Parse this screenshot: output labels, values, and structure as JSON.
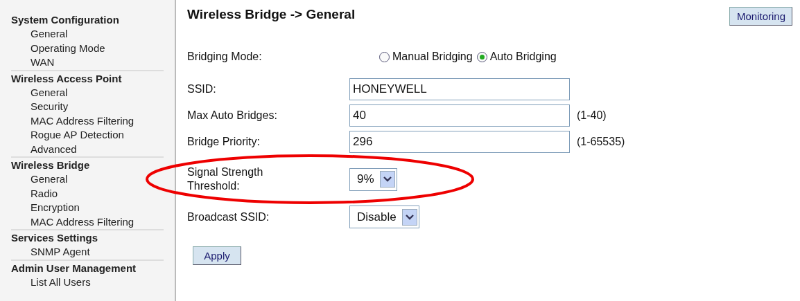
{
  "sidebar": {
    "groups": [
      {
        "title": "System Configuration",
        "items": [
          {
            "label": "General"
          },
          {
            "label": "Operating Mode"
          },
          {
            "label": "WAN"
          }
        ]
      },
      {
        "title": "Wireless Access Point",
        "items": [
          {
            "label": "General"
          },
          {
            "label": "Security"
          },
          {
            "label": "MAC Address Filtering"
          },
          {
            "label": "Rogue AP Detection"
          },
          {
            "label": "Advanced"
          }
        ]
      },
      {
        "title": "Wireless Bridge",
        "items": [
          {
            "label": "General"
          },
          {
            "label": "Radio"
          },
          {
            "label": "Encryption"
          },
          {
            "label": "MAC Address Filtering"
          }
        ]
      },
      {
        "title": "Services Settings",
        "items": [
          {
            "label": "SNMP Agent"
          }
        ]
      },
      {
        "title": "Admin User Management",
        "items": [
          {
            "label": "List All Users"
          }
        ]
      }
    ]
  },
  "page_title": "Wireless Bridge -> General",
  "monitoring_button": "Monitoring",
  "bridging_mode": {
    "label": "Bridging Mode:",
    "options": [
      {
        "label": "Manual Bridging",
        "selected": false
      },
      {
        "label": "Auto Bridging",
        "selected": true
      }
    ]
  },
  "fields": [
    {
      "kind": "text",
      "label": "SSID:",
      "value": "HONEYWELL"
    },
    {
      "kind": "text",
      "label": "Max Auto Bridges:",
      "value": "40",
      "range": "(1-40)"
    },
    {
      "kind": "text",
      "label": "Bridge Priority:",
      "value": "296",
      "range": "(1-65535)"
    },
    {
      "kind": "select",
      "label": "Signal Strength Threshold:",
      "value": "9%"
    },
    {
      "kind": "select",
      "label": "Broadcast SSID:",
      "value": "Disable"
    }
  ],
  "apply_button": "Apply",
  "annotation": {
    "kind": "ellipse"
  }
}
